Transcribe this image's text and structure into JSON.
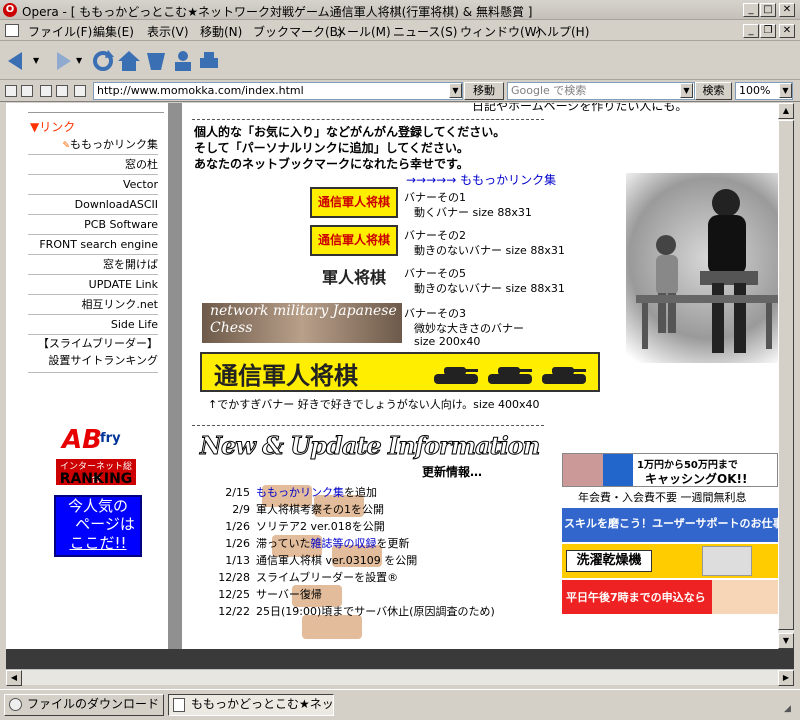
{
  "window": {
    "title": "Opera - [ ももっかどっとこむ★ネットワーク対戦ゲーム通信軍人将棋(行軍将棋) & 無料懸賞 ]",
    "icon": "opera-icon"
  },
  "menu": [
    "ファイル(F)",
    "編集(E)",
    "表示(V)",
    "移動(N)",
    "ブックマーク(B)",
    "メール(M)",
    "ニュース(S)",
    "ウィンドウ(W)",
    "ヘルプ(H)"
  ],
  "address": {
    "url": "http://www.momokka.com/index.html",
    "go_label": "移動",
    "search_placeholder": "Google で検索",
    "search_button": "検索",
    "zoom": "100%"
  },
  "top_partial": "日記やホームページを作りたい人にも。",
  "sidebar": {
    "header": "▼リンク",
    "items": [
      "ももっかリンク集",
      "窓の杜",
      "Vector",
      "DownloadASCII",
      "PCB Software",
      "FRONT search engine",
      "窓を開けば",
      "UPDATE Link",
      "相互リンク.net",
      "Side Life",
      "【スライムブリーダー】設置サイトランキング"
    ],
    "ranking_logo": "ABfry インターネット総合 RANKING",
    "popular": [
      "今人気の",
      "ページは",
      "ここだ!!"
    ]
  },
  "main": {
    "intro": [
      "個人的な「お気に入り」などがんがん登録してください。",
      "そして「パーソナルリンクに追加」してください。",
      "あなたのネットブックマークになれたら幸せです。"
    ],
    "link_arrow": "→→→→→",
    "link_text": "ももっかリンク集",
    "banners": [
      {
        "img": "通信軍人将棋",
        "title": "バナーその1",
        "desc": "動くバナー size 88x31"
      },
      {
        "img": "通信軍人将棋",
        "title": "バナーその2",
        "desc": "動きのないバナー size 88x31"
      },
      {
        "img": "軍人将棋",
        "title": "バナーその5",
        "desc": "動きのないバナー size 88x31"
      },
      {
        "img": "network military Japanese Chess",
        "title": "バナーその3",
        "desc1": "微妙な大きさのバナー",
        "desc2": "size 200x40"
      }
    ],
    "big_banner_text": "通信軍人将棋",
    "big_banner_caption": "↑でかすぎバナー 好きで好きでしょうがない人向け。size 400x40",
    "news_header": "New & Update Information",
    "news_sub": "更新情報…",
    "news": [
      {
        "date": "2/15",
        "pre": "",
        "link": "ももっかリンク集",
        "post": "を追加"
      },
      {
        "date": "2/9",
        "pre": "軍人将棋考察その1を公開",
        "link": "",
        "post": ""
      },
      {
        "date": "1/26",
        "pre": "ソリテア2 ver.018を公開",
        "link": "",
        "post": ""
      },
      {
        "date": "1/26",
        "pre": "滞っていた",
        "link": "雑誌等の収録",
        "post": "を更新"
      },
      {
        "date": "1/13",
        "pre": "通信軍人将棋 ver.03109 を公開",
        "link": "",
        "post": ""
      },
      {
        "date": "12/28",
        "pre": "スライムブリーダーを設置®",
        "link": "",
        "post": ""
      },
      {
        "date": "12/25",
        "pre": "サーバー復帰",
        "link": "",
        "post": ""
      },
      {
        "date": "12/22",
        "pre": "25日(19:00)頃までサーバ休止(原因調査のため)",
        "link": "",
        "post": ""
      }
    ]
  },
  "ads": {
    "ad1_line1": "1万円から50万円まで",
    "ad1_line2": "キャッシングOK!!",
    "ad1_caption": "年会費・入会費不要 一週間無利息",
    "ad2": "スキルを磨こう！ユーザーサポートのお仕事特集",
    "ad3": "洗濯乾燥機",
    "ad4": "平日午後7時までの申込なら"
  },
  "taskbar": {
    "task1": "ファイルのダウンロード",
    "task2": "ももっかどっとこむ★ネット..."
  },
  "colors": {
    "accent": "#0000cc",
    "sidebar_header": "#ff3300"
  }
}
